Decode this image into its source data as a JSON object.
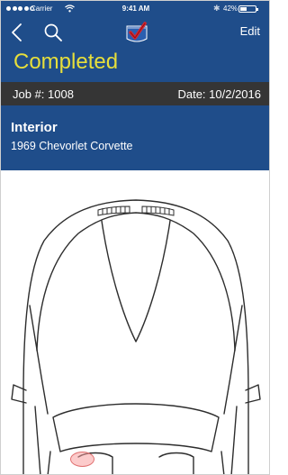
{
  "status_bar": {
    "carrier": "Carrier",
    "time": "9:41 AM",
    "battery_percent": "42%",
    "battery_level": 0.42
  },
  "nav": {
    "back_icon": "chevron-left-icon",
    "search_icon": "search-icon",
    "logo_icon": "app-logo-checkmark",
    "edit_label": "Edit"
  },
  "status": {
    "label": "Completed"
  },
  "job": {
    "number_label": "Job #: 1008",
    "date_label": "Date: 10/2/2016"
  },
  "section": {
    "title": "Interior",
    "vehicle": "1969 Chevorlet Corvette"
  },
  "colors": {
    "header_blue": "#1f4d8a",
    "status_yellow": "#e7df3b",
    "job_bar": "#353535",
    "damage_marker": "#faa0a0"
  }
}
